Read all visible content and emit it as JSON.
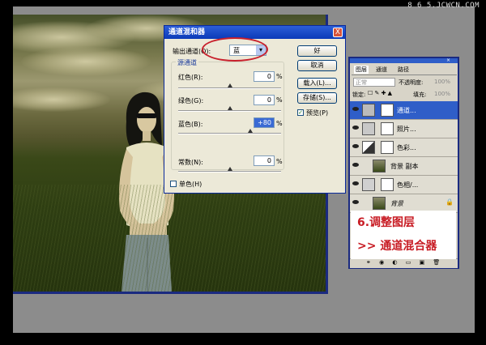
{
  "watermark": "8 6 5.JCWCN.COM",
  "dialog": {
    "title": "通道混和器",
    "output_channel_label": "输出通道(O):",
    "output_channel_value": "蓝",
    "source_group_label": "源通道",
    "channels": [
      {
        "label": "红色(R):",
        "value": "0",
        "unit": "%",
        "level": 0
      },
      {
        "label": "绿色(G):",
        "value": "0",
        "unit": "%",
        "level": 0
      },
      {
        "label": "蓝色(B):",
        "value": "+80",
        "unit": "%",
        "level": 80
      }
    ],
    "constant": {
      "label": "常数(N):",
      "value": "0",
      "unit": "%",
      "level": 0
    },
    "monochrome_label": "单色(H)",
    "monochrome_checked": false,
    "buttons": {
      "ok": "好",
      "cancel": "取消",
      "load": "载入(L)...",
      "save": "存储(S)..."
    },
    "preview_label": "预览(P)",
    "preview_checked": true,
    "close_glyph": "X"
  },
  "layers_panel": {
    "tabs": [
      "图层",
      "通道",
      "路径"
    ],
    "blend_mode": "正常",
    "opacity_label": "不透明度:",
    "opacity_value": "100%",
    "lock_label": "锁定:",
    "fill_label": "填充:",
    "fill_value": "100%",
    "layers": [
      {
        "name": "通道...",
        "selected": true
      },
      {
        "name": "照片...",
        "selected": false
      },
      {
        "name": "色彩...",
        "selected": false
      },
      {
        "name": "背景 副本",
        "selected": false
      },
      {
        "name": "色相/...",
        "selected": false
      },
      {
        "name": "背景",
        "selected": false
      }
    ]
  },
  "annotation": {
    "step": "6.调整图层",
    "detail": ">> 通道混合器"
  }
}
